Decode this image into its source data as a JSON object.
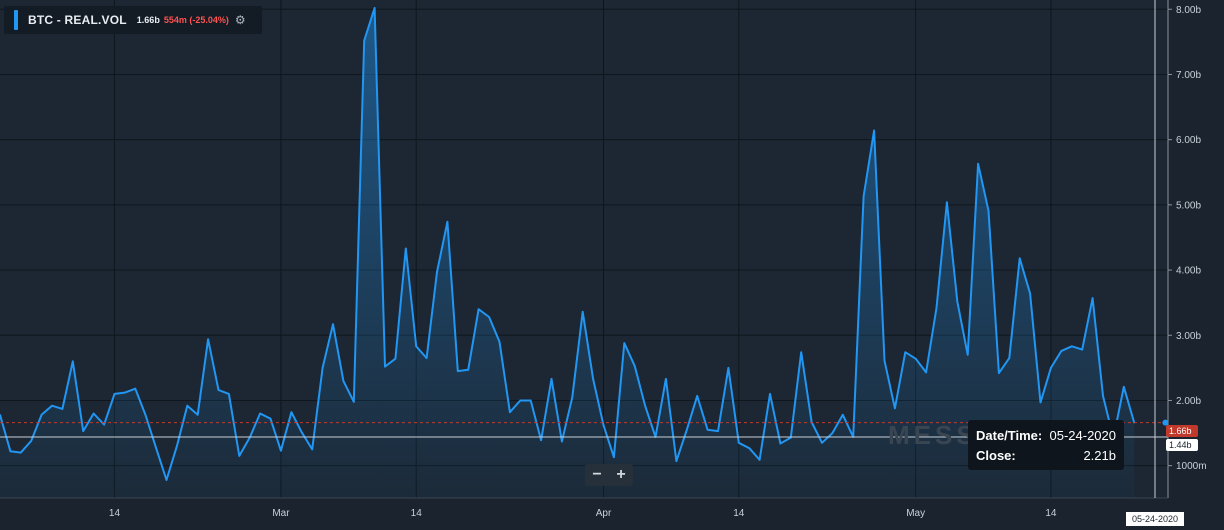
{
  "legend": {
    "symbol": "BTC - REAL.VOL",
    "last_value": "1.66b",
    "change": "554m (-25.04%)",
    "settings_icon": "gear-icon",
    "series_color": "#2196f3",
    "change_color": "#ff5252"
  },
  "tooltip": {
    "date_label": "Date/Time:",
    "date_value": "05-24-2020",
    "close_label": "Close:",
    "close_value": "2.21b"
  },
  "watermark": "MESSARI",
  "price_tags": {
    "last": "1.66b",
    "crosshair": "1.44b"
  },
  "crosshair_date": "05-24-2020",
  "zoom": {
    "out": "−",
    "in": "+"
  },
  "colors": {
    "background": "#1a232e",
    "line": "#2196f3",
    "last_price_line": "#c0392b"
  },
  "chart_data": {
    "type": "area",
    "title": "BTC - REAL.VOL",
    "ylim": [
      0.55,
      8.05
    ],
    "y_unit": "billions",
    "y_ticks": [
      {
        "value": 1.0,
        "label": "1000m"
      },
      {
        "value": 2.0,
        "label": "2.00b"
      },
      {
        "value": 3.0,
        "label": "3.00b"
      },
      {
        "value": 4.0,
        "label": "4.00b"
      },
      {
        "value": 5.0,
        "label": "5.00b"
      },
      {
        "value": 6.0,
        "label": "6.00b"
      },
      {
        "value": 7.0,
        "label": "7.00b"
      },
      {
        "value": 8.0,
        "label": "8.00b"
      }
    ],
    "x_ticks": [
      {
        "date": "2020-02-14",
        "label": "14"
      },
      {
        "date": "2020-03-01",
        "label": "Mar"
      },
      {
        "date": "2020-03-14",
        "label": "14"
      },
      {
        "date": "2020-04-01",
        "label": "Apr"
      },
      {
        "date": "2020-04-14",
        "label": "14"
      },
      {
        "date": "2020-05-01",
        "label": "May"
      },
      {
        "date": "2020-05-14",
        "label": "14"
      }
    ],
    "last_value": 1.66,
    "crosshair_value": 1.44,
    "crosshair_date": "2020-05-24",
    "x": [
      "2020-02-03",
      "2020-02-04",
      "2020-02-05",
      "2020-02-06",
      "2020-02-07",
      "2020-02-08",
      "2020-02-09",
      "2020-02-10",
      "2020-02-11",
      "2020-02-12",
      "2020-02-13",
      "2020-02-14",
      "2020-02-15",
      "2020-02-16",
      "2020-02-17",
      "2020-02-18",
      "2020-02-19",
      "2020-02-20",
      "2020-02-21",
      "2020-02-22",
      "2020-02-23",
      "2020-02-24",
      "2020-02-25",
      "2020-02-26",
      "2020-02-27",
      "2020-02-28",
      "2020-02-29",
      "2020-03-01",
      "2020-03-02",
      "2020-03-03",
      "2020-03-04",
      "2020-03-05",
      "2020-03-06",
      "2020-03-07",
      "2020-03-08",
      "2020-03-09",
      "2020-03-10",
      "2020-03-11",
      "2020-03-12",
      "2020-03-13",
      "2020-03-14",
      "2020-03-15",
      "2020-03-16",
      "2020-03-17",
      "2020-03-18",
      "2020-03-19",
      "2020-03-20",
      "2020-03-21",
      "2020-03-22",
      "2020-03-23",
      "2020-03-24",
      "2020-03-25",
      "2020-03-26",
      "2020-03-27",
      "2020-03-28",
      "2020-03-29",
      "2020-03-30",
      "2020-03-31",
      "2020-04-01",
      "2020-04-02",
      "2020-04-03",
      "2020-04-04",
      "2020-04-05",
      "2020-04-06",
      "2020-04-07",
      "2020-04-08",
      "2020-04-09",
      "2020-04-10",
      "2020-04-11",
      "2020-04-12",
      "2020-04-13",
      "2020-04-14",
      "2020-04-15",
      "2020-04-16",
      "2020-04-17",
      "2020-04-18",
      "2020-04-19",
      "2020-04-20",
      "2020-04-21",
      "2020-04-22",
      "2020-04-23",
      "2020-04-24",
      "2020-04-25",
      "2020-04-26",
      "2020-04-27",
      "2020-04-28",
      "2020-04-29",
      "2020-04-30",
      "2020-05-01",
      "2020-05-02",
      "2020-05-03",
      "2020-05-04",
      "2020-05-05",
      "2020-05-06",
      "2020-05-07",
      "2020-05-08",
      "2020-05-09",
      "2020-05-10",
      "2020-05-11",
      "2020-05-12",
      "2020-05-13",
      "2020-05-14",
      "2020-05-15",
      "2020-05-16",
      "2020-05-17",
      "2020-05-18",
      "2020-05-19",
      "2020-05-20",
      "2020-05-21",
      "2020-05-22",
      "2020-05-23",
      "2020-05-24",
      "2020-05-25"
    ],
    "series": [
      {
        "values": [
          1.78,
          1.22,
          1.2,
          1.38,
          1.78,
          1.92,
          1.87,
          2.6,
          1.53,
          1.8,
          1.63,
          2.1,
          2.12,
          2.18,
          1.77,
          1.27,
          0.78,
          1.3,
          1.92,
          1.78,
          2.94,
          2.16,
          2.1,
          1.15,
          1.43,
          1.8,
          1.72,
          1.23,
          1.82,
          1.51,
          1.25,
          2.5,
          3.17,
          2.3,
          1.98,
          7.52,
          8.02,
          2.52,
          2.64,
          4.33,
          2.83,
          2.65,
          3.97,
          4.74,
          2.45,
          2.47,
          3.4,
          3.28,
          2.9,
          1.82,
          2.0,
          2.0,
          1.39,
          2.33,
          1.37,
          2.05,
          3.36,
          2.33,
          1.62,
          1.13,
          2.88,
          2.53,
          1.92,
          1.44,
          2.33,
          1.07,
          1.55,
          2.07,
          1.55,
          1.53,
          2.5,
          1.35,
          1.27,
          1.09,
          2.1,
          1.34,
          1.43,
          2.74,
          1.67,
          1.35,
          1.5,
          1.78,
          1.44,
          5.13,
          6.14,
          2.61,
          1.88,
          2.74,
          2.64,
          2.43,
          3.42,
          5.04,
          3.52,
          2.7,
          5.63,
          4.91,
          2.42,
          2.65,
          4.18,
          3.64,
          1.97,
          2.5,
          2.76,
          2.83,
          2.78,
          3.57,
          2.07,
          1.42,
          2.21,
          1.66
        ]
      }
    ]
  }
}
